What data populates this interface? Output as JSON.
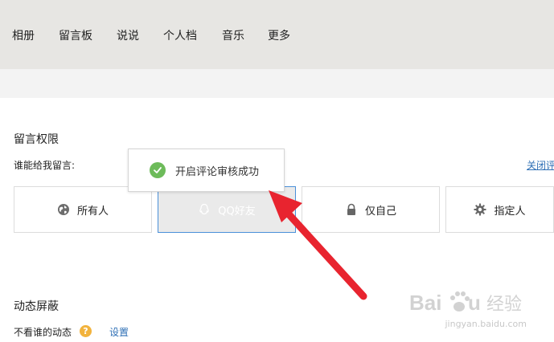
{
  "nav": {
    "items": [
      "相册",
      "留言板",
      "说说",
      "个人档",
      "音乐",
      "更多"
    ]
  },
  "permissions": {
    "title": "留言权限",
    "who_label": "谁能给我留言:",
    "right_link": "关闭评",
    "options": [
      {
        "label": "所有人",
        "icon": "globe-icon"
      },
      {
        "label": "QQ好友",
        "icon": "qq-penguin-icon",
        "selected": true
      },
      {
        "label": "仅自己",
        "icon": "lock-icon"
      },
      {
        "label": "指定人",
        "icon": "gear-icon"
      }
    ]
  },
  "toast": {
    "message": "开启评论审核成功",
    "icon": "check-circle-icon"
  },
  "dynamic": {
    "title": "动态屏蔽",
    "not_see_label": "不看谁的动态",
    "help_icon_text": "?",
    "settings_link": "设置"
  },
  "watermark": {
    "brand": "Baidu经验",
    "url": "jingyan.baidu.com"
  },
  "colors": {
    "accent_blue": "#2e6fb5",
    "selected_border": "#4a90d9",
    "success_green": "#6dbb5a",
    "arrow_red": "#e8242f",
    "help_orange": "#f2b33d"
  }
}
